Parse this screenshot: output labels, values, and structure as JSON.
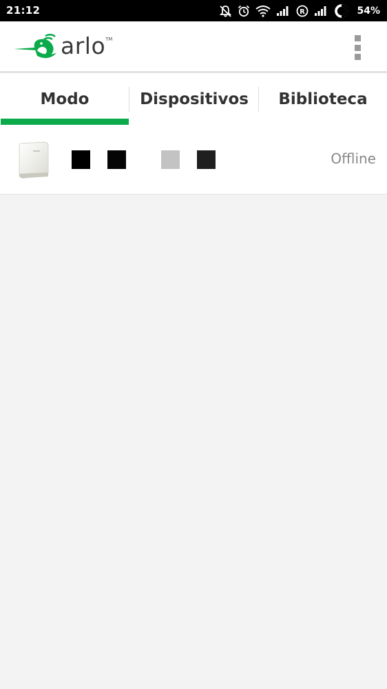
{
  "status_bar": {
    "time": "21:12",
    "battery": "54%",
    "icons": [
      "notifications-off-icon",
      "alarm-icon",
      "wifi-icon",
      "signal-icon",
      "roaming-icon",
      "signal-icon",
      "battery-icon"
    ]
  },
  "app_bar": {
    "logo_text": "arlo",
    "logo_tm": "TM",
    "menu_icon": "overflow-menu-icon"
  },
  "tabs": [
    {
      "label": "Modo",
      "active": true
    },
    {
      "label": "Dispositivos",
      "active": false
    },
    {
      "label": "Biblioteca",
      "active": false
    }
  ],
  "devices": [
    {
      "name": "",
      "name_redacted": true,
      "status": "Offline",
      "icon": "base-station-icon"
    }
  ],
  "colors": {
    "accent": "#0bab4b",
    "background": "#f3f3f3",
    "status_text": "#888888"
  }
}
